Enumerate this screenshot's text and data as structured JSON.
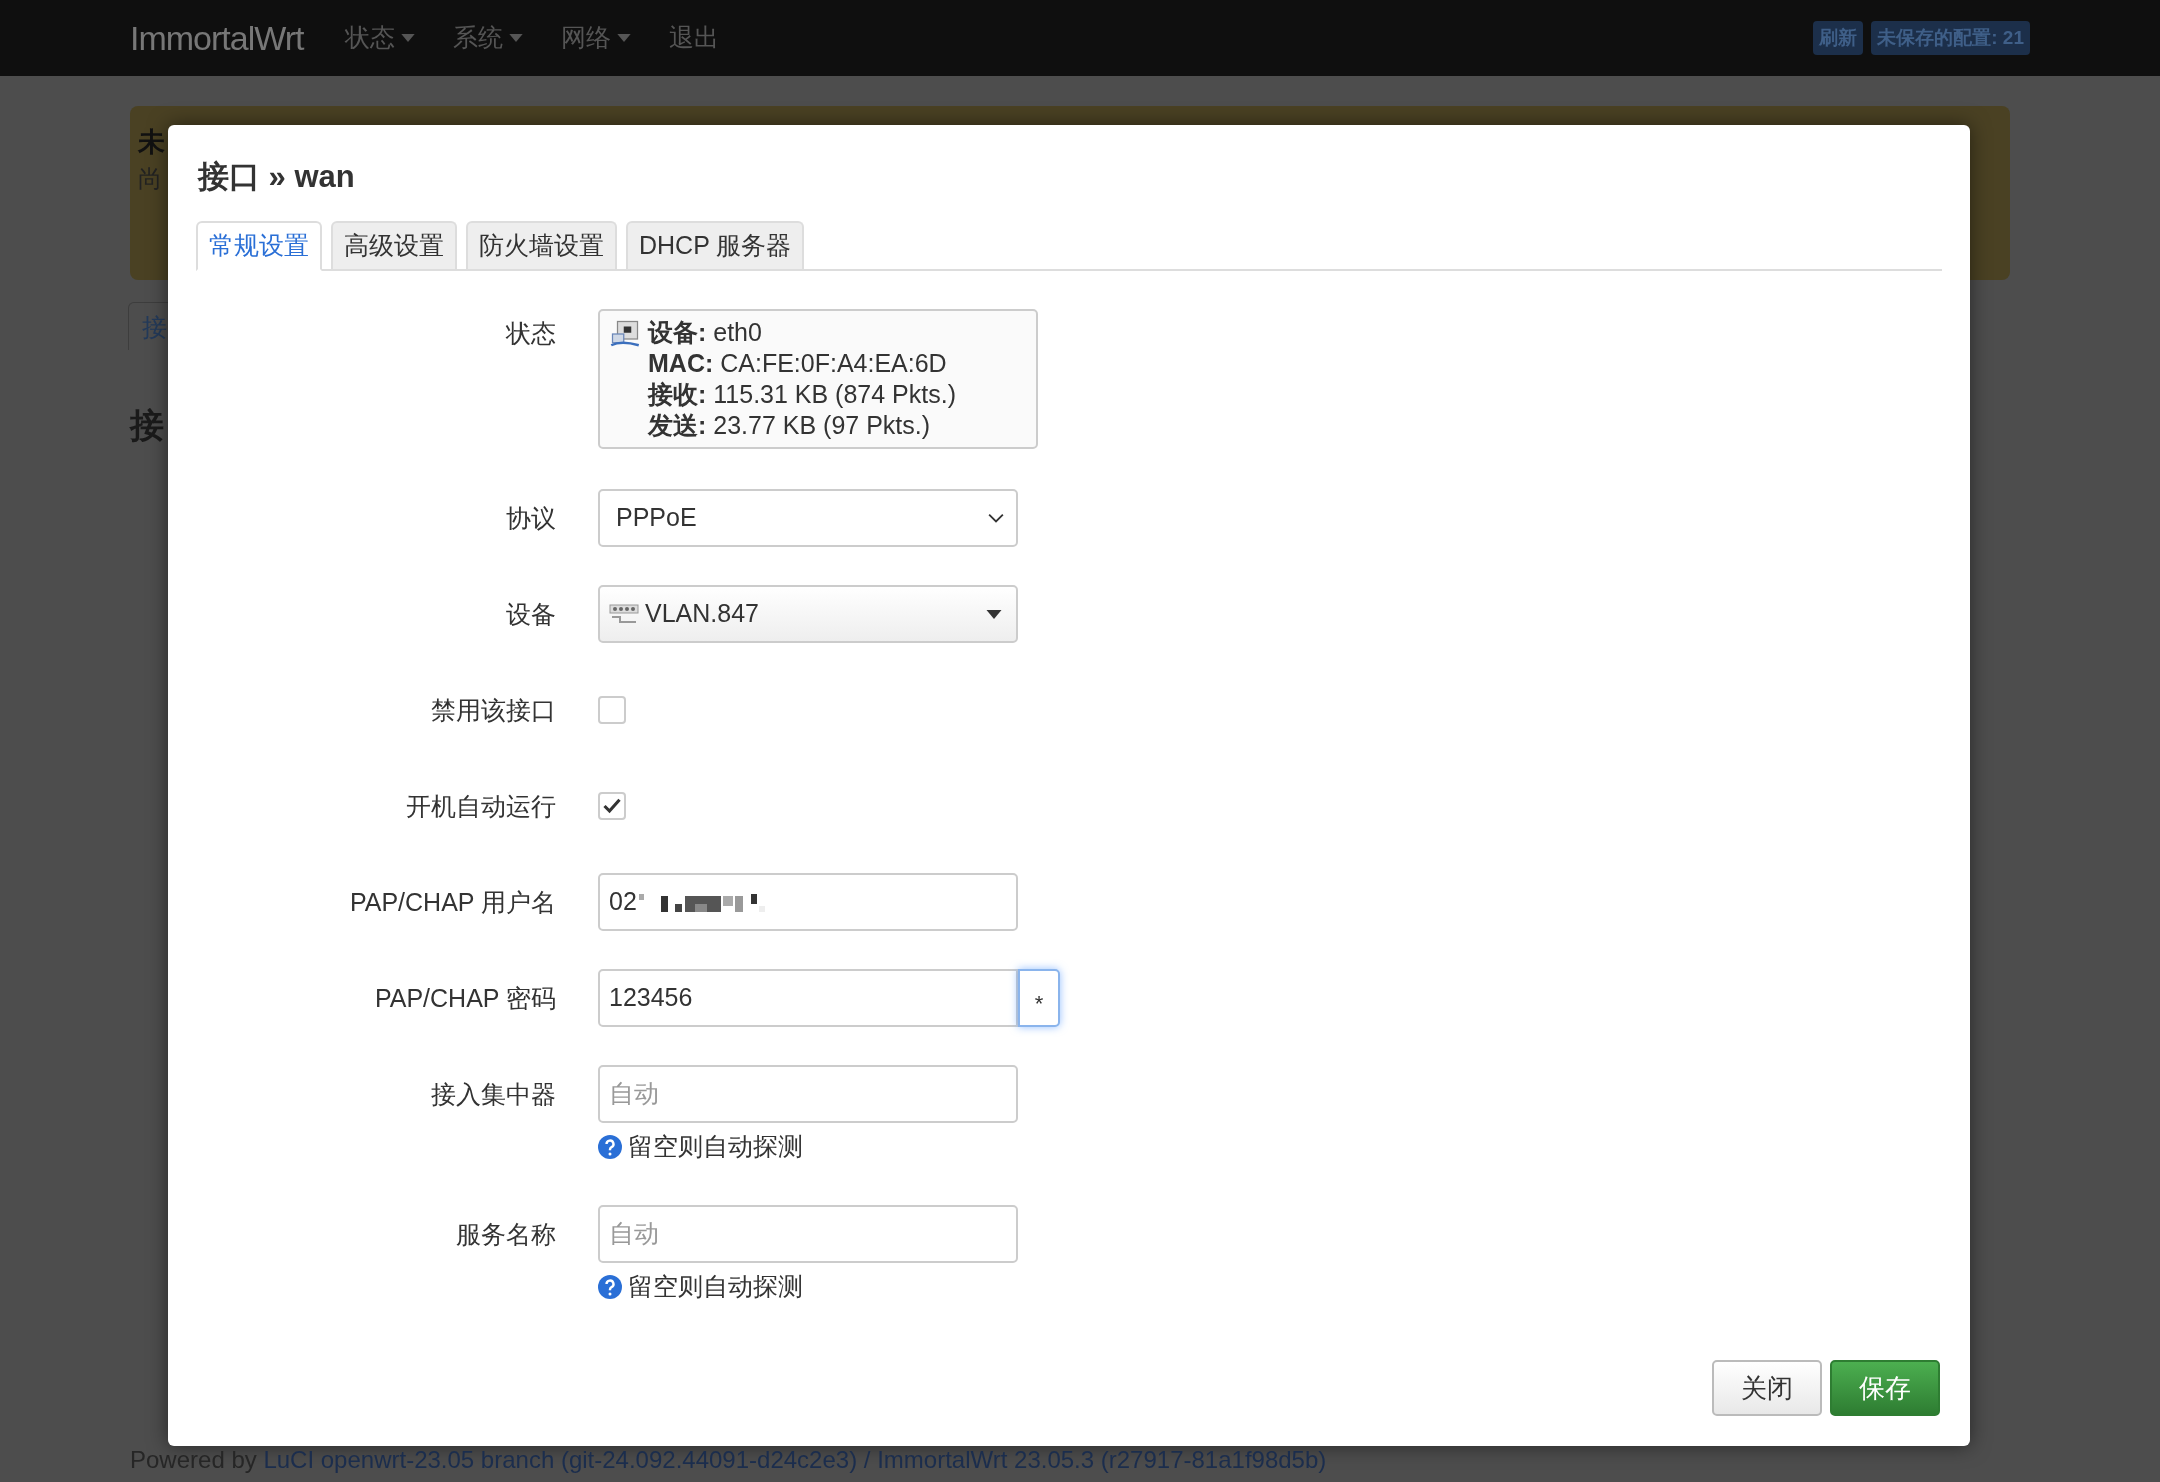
{
  "navbar": {
    "brand": "ImmortalWrt",
    "menu": [
      {
        "label": "状态",
        "dropdown": true
      },
      {
        "label": "系统",
        "dropdown": true
      },
      {
        "label": "网络",
        "dropdown": true
      },
      {
        "label": "退出",
        "dropdown": false
      }
    ],
    "badges": [
      "刷新",
      "未保存的配置: 21"
    ]
  },
  "background": {
    "alert_fragments": [
      "未",
      "尚"
    ],
    "tab_fragment": "接",
    "heading_fragment": "接"
  },
  "modal": {
    "title": "接口 » wan",
    "tabs": [
      {
        "label": "常规设置",
        "selected": true
      },
      {
        "label": "高级设置",
        "selected": false
      },
      {
        "label": "防火墙设置",
        "selected": false
      },
      {
        "label": "DHCP 服务器",
        "selected": false
      }
    ],
    "fields": [
      {
        "kind": "status",
        "label": "状态",
        "lines": [
          {
            "key": "设备:",
            "value": " eth0"
          },
          {
            "key": "MAC:",
            "value": " CA:FE:0F:A4:EA:6D"
          },
          {
            "key": "接收:",
            "value": " 115.31 KB (874 Pkts.)"
          },
          {
            "key": "发送:",
            "value": " 23.77 KB (97 Pkts.)"
          }
        ]
      },
      {
        "kind": "select",
        "label": "协议",
        "value": "PPPoE"
      },
      {
        "kind": "device",
        "label": "设备",
        "value": "VLAN.847"
      },
      {
        "kind": "checkbox",
        "label": "禁用该接口",
        "checked": false
      },
      {
        "kind": "checkbox",
        "label": "开机自动运行",
        "checked": true
      },
      {
        "kind": "text",
        "label": "PAP/CHAP 用户名",
        "value": "02",
        "redacted": true
      },
      {
        "kind": "password",
        "label": "PAP/CHAP 密码",
        "value": "123456",
        "reveal": "*"
      },
      {
        "kind": "text",
        "label": "接入集中器",
        "placeholder": "自动",
        "help": "留空则自动探测"
      },
      {
        "kind": "text",
        "label": "服务名称",
        "placeholder": "自动",
        "help": "留空则自动探测"
      }
    ],
    "buttons": [
      {
        "label": "关闭",
        "kind": "close"
      },
      {
        "label": "保存",
        "kind": "save"
      }
    ]
  },
  "footer": {
    "prefix": "Powered by",
    "links": [
      "LuCI openwrt-23.05 branch (git-24.092.44091-d24c2e3)",
      "ImmortalWrt 23.05.3 (r27917-81a1f98d5b)"
    ],
    "separator": "/"
  }
}
